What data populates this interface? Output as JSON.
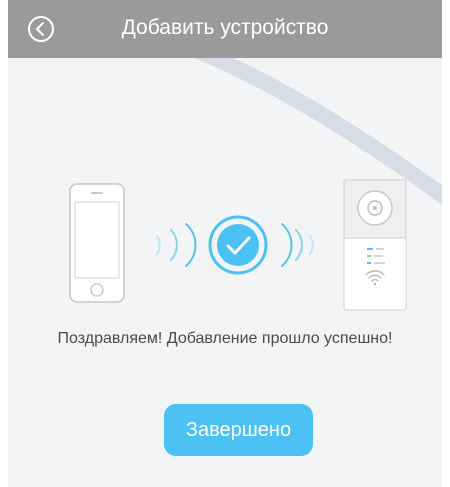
{
  "header": {
    "title": "Добавить устройство",
    "back_icon": "chevron-left-icon"
  },
  "illustration": {
    "phone_icon": "smartphone-icon",
    "device_icon": "camera-hub-icon",
    "status_icon": "checkmark-icon"
  },
  "main": {
    "message": "Поздравляем! Добавление прошло успешно!",
    "done_label": "Завершено"
  },
  "colors": {
    "accent": "#4cc1f3",
    "header_bg": "#9a9a9a",
    "background": "#f3f4f6"
  }
}
